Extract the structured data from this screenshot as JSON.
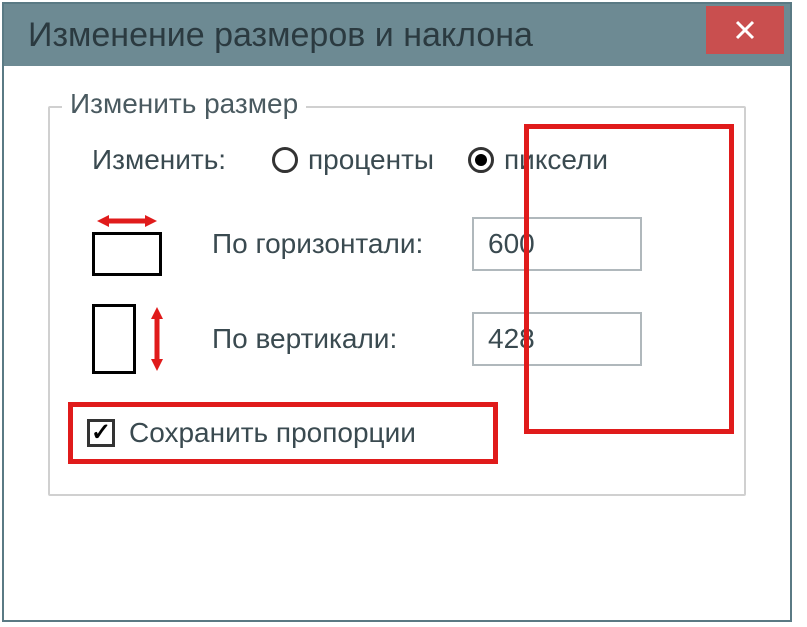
{
  "window": {
    "title": "Изменение размеров и наклона"
  },
  "group": {
    "legend": "Изменить размер",
    "resize_by_label": "Изменить:",
    "percent_label": "проценты",
    "pixels_label": "пиксели",
    "horizontal_label": "По горизонтали:",
    "vertical_label": "По вертикали:",
    "horizontal_value": "600",
    "vertical_value": "428",
    "keep_ratio_label": "Сохранить пропорции"
  }
}
